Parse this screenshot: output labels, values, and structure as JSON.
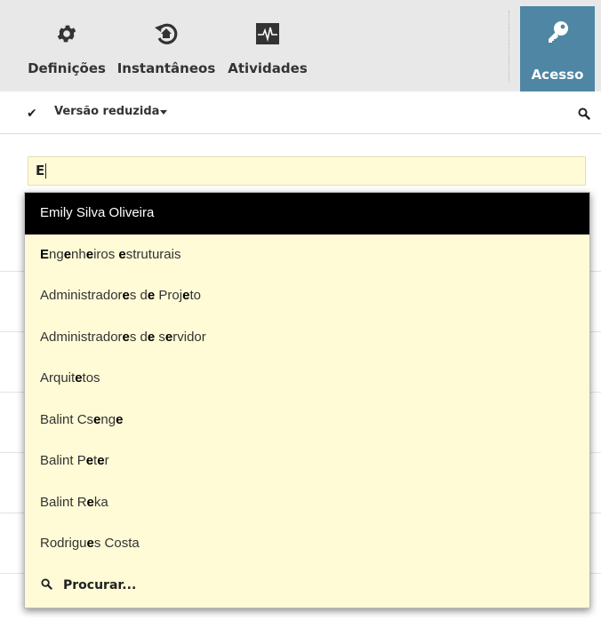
{
  "toolbar": {
    "definicoes_label": "Definições",
    "instantaneos_label": "Instantâneos",
    "atividades_label": "Atividades",
    "acesso_label": "Acesso"
  },
  "subbar": {
    "version_label": "Versão reduzida"
  },
  "search": {
    "value": "E"
  },
  "dropdown": {
    "items": [
      {
        "segments": [
          {
            "t": "Emily Silva Oliveira",
            "b": false
          }
        ],
        "active": true
      },
      {
        "segments": [
          {
            "t": "E",
            "b": true
          },
          {
            "t": "ng",
            "b": false
          },
          {
            "t": "e",
            "b": true
          },
          {
            "t": "nh",
            "b": false
          },
          {
            "t": "e",
            "b": true
          },
          {
            "t": "iros ",
            "b": false
          },
          {
            "t": "e",
            "b": true
          },
          {
            "t": "struturais",
            "b": false
          }
        ],
        "active": false
      },
      {
        "segments": [
          {
            "t": "Administrador",
            "b": false
          },
          {
            "t": "e",
            "b": true
          },
          {
            "t": "s d",
            "b": false
          },
          {
            "t": "e",
            "b": true
          },
          {
            "t": " Proj",
            "b": false
          },
          {
            "t": "e",
            "b": true
          },
          {
            "t": "to",
            "b": false
          }
        ],
        "active": false
      },
      {
        "segments": [
          {
            "t": "Administrador",
            "b": false
          },
          {
            "t": "e",
            "b": true
          },
          {
            "t": "s d",
            "b": false
          },
          {
            "t": "e",
            "b": true
          },
          {
            "t": " s",
            "b": false
          },
          {
            "t": "e",
            "b": true
          },
          {
            "t": "rvidor",
            "b": false
          }
        ],
        "active": false
      },
      {
        "segments": [
          {
            "t": "Arquit",
            "b": false
          },
          {
            "t": "e",
            "b": true
          },
          {
            "t": "tos",
            "b": false
          }
        ],
        "active": false
      },
      {
        "segments": [
          {
            "t": "Balint Cs",
            "b": false
          },
          {
            "t": "e",
            "b": true
          },
          {
            "t": "ng",
            "b": false
          },
          {
            "t": "e",
            "b": true
          }
        ],
        "active": false
      },
      {
        "segments": [
          {
            "t": "Balint P",
            "b": false
          },
          {
            "t": "e",
            "b": true
          },
          {
            "t": "t",
            "b": false
          },
          {
            "t": "e",
            "b": true
          },
          {
            "t": "r",
            "b": false
          }
        ],
        "active": false
      },
      {
        "segments": [
          {
            "t": "Balint R",
            "b": false
          },
          {
            "t": "e",
            "b": true
          },
          {
            "t": "ka",
            "b": false
          }
        ],
        "active": false
      },
      {
        "segments": [
          {
            "t": "Rodrigu",
            "b": false
          },
          {
            "t": "e",
            "b": true
          },
          {
            "t": "s Costa",
            "b": false
          }
        ],
        "active": false
      }
    ],
    "search_more_label": "Procurar..."
  },
  "icons": {
    "definicoes": "gear-icon",
    "instantaneos": "snapshot-restore-icon",
    "atividades": "activity-pulse-icon",
    "acesso": "key-icon",
    "version_check": "check-icon",
    "version_caret": "caret-down-icon",
    "top_search": "search-icon",
    "dropdown_search": "search-icon"
  },
  "colors": {
    "accent": "#4e86a4",
    "toolbar_bg": "#e8e8e8",
    "dropdown_bg": "#fffbd6",
    "highlight": "#000000"
  }
}
